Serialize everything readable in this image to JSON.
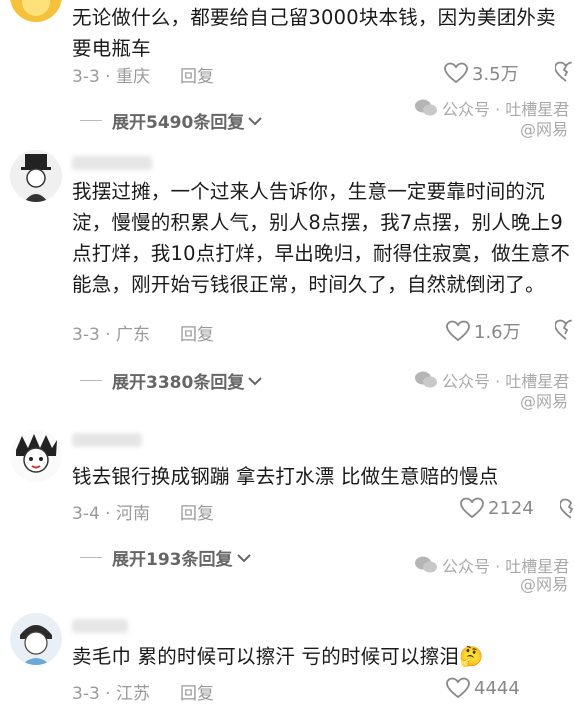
{
  "comments": [
    {
      "text": "无论做什么，都要给自己留3000块本钱，因为美团外卖要电瓶车",
      "date_location": "3-3 · 重庆",
      "reply_label": "回复",
      "likes": "3.5万",
      "expand_label": "展开5490条回复"
    },
    {
      "text": "我摆过摊，一个过来人告诉你，生意一定要靠时间的沉淀，慢慢的积累人气，别人8点摆，我7点摆，别人晚上9点打烊，我10点打烊，早出晚归，耐得住寂寞，做生意不能急，刚开始亏钱很正常，时间久了，自然就倒闭了。",
      "date_location": "3-3 · 广东",
      "reply_label": "回复",
      "likes": "1.6万",
      "expand_label": "展开3380条回复"
    },
    {
      "text": "钱去银行换成钢蹦 拿去打水漂 比做生意赔的慢点",
      "date_location": "3-4 · 河南",
      "reply_label": "回复",
      "likes": "2124",
      "expand_label": "展开193条回复"
    },
    {
      "text": "卖毛巾 累的时候可以擦汗 亏的时候可以擦泪🤔",
      "date_location": "3-3 · 江苏",
      "reply_label": "回复",
      "likes": "4444"
    }
  ],
  "watermark": {
    "text": "公众号 · 吐槽星君",
    "weibo": "@网易"
  },
  "colors": {
    "meta_gray": "#9a9a9a",
    "text": "#1a1a1a",
    "watermark": "#a9a9a9"
  }
}
